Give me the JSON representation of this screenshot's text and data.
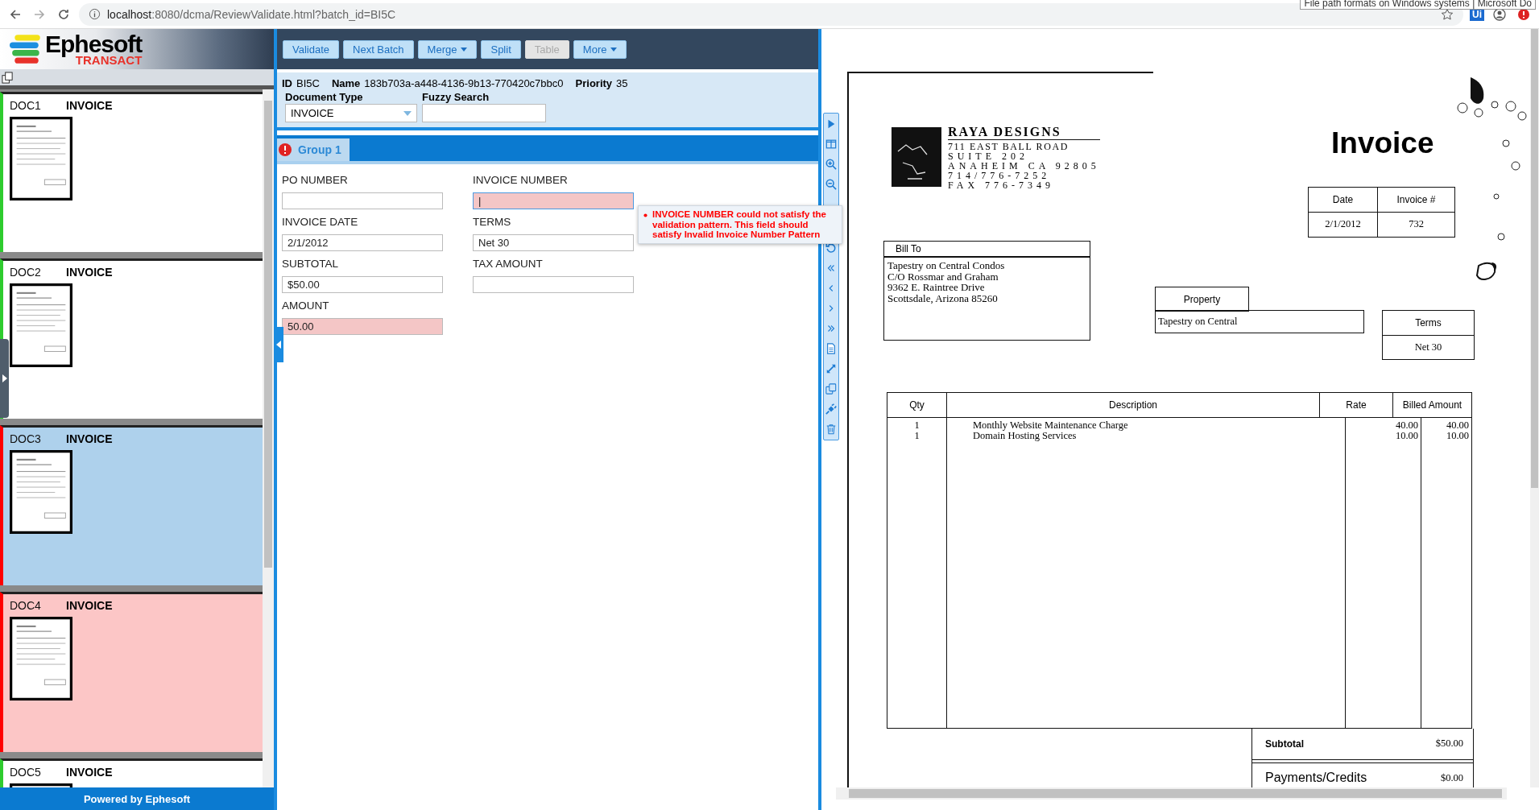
{
  "browser": {
    "url_host": "localhost",
    "url_path": ":8080/dcma/ReviewValidate.html?batch_id=BI5C",
    "tooltip": "File path formats on Windows systems | Microsoft Do",
    "extension_label": "Ui"
  },
  "logo": {
    "name": "Ephesoft",
    "tagline": "TRANSACT"
  },
  "documents": [
    {
      "id": "DOC1",
      "type": "INVOICE",
      "valid": true,
      "selected": false
    },
    {
      "id": "DOC2",
      "type": "INVOICE",
      "valid": true,
      "selected": false
    },
    {
      "id": "DOC3",
      "type": "INVOICE",
      "valid": false,
      "selected": true
    },
    {
      "id": "DOC4",
      "type": "INVOICE",
      "valid": false,
      "selected": false
    },
    {
      "id": "DOC5",
      "type": "INVOICE",
      "valid": true,
      "selected": false
    }
  ],
  "footer": "Powered by Ephesoft",
  "toolbar": [
    {
      "label": "Validate",
      "dropdown": false,
      "disabled": false
    },
    {
      "label": "Next Batch",
      "dropdown": false,
      "disabled": false
    },
    {
      "label": "Merge",
      "dropdown": true,
      "disabled": false
    },
    {
      "label": "Split",
      "dropdown": false,
      "disabled": false
    },
    {
      "label": "Table",
      "dropdown": false,
      "disabled": true
    },
    {
      "label": "More",
      "dropdown": true,
      "disabled": false
    }
  ],
  "batch": {
    "id_label": "ID",
    "id": "BI5C",
    "name_label": "Name",
    "name": "183b703a-a448-4136-9b13-770420c7bbc0",
    "priority_label": "Priority",
    "priority": "35"
  },
  "document_type": {
    "label": "Document Type",
    "value": "INVOICE"
  },
  "fuzzy_search": {
    "label": "Fuzzy Search"
  },
  "group_tab": {
    "label": "Group 1",
    "error": true
  },
  "fields": [
    {
      "label": "PO NUMBER",
      "error": false,
      "focused": false
    },
    {
      "label": "INVOICE NUMBER",
      "value": "|",
      "error": true,
      "focused": true
    },
    {
      "label": "INVOICE DATE",
      "value": "2/1/2012",
      "error": false,
      "focused": false
    },
    {
      "label": "TERMS",
      "value": "Net 30",
      "error": false,
      "focused": false
    },
    {
      "label": "SUBTOTAL",
      "value": "$50.00",
      "error": false,
      "focused": false
    },
    {
      "label": "TAX AMOUNT",
      "error": false,
      "focused": false
    },
    {
      "label": "AMOUNT",
      "value": "50.00",
      "error": true,
      "focused": false
    }
  ],
  "validation_message": "INVOICE NUMBER could not satisfy the validation pattern. This field should satisfy Invalid Invoice Number Pattern",
  "invoice": {
    "company": "RAYA DESIGNS",
    "address_lines": [
      "711 EAST BALL ROAD",
      "SUITE 202",
      "ANAHEIM CA 92805",
      "714/776-7252",
      "FAX 776-7349"
    ],
    "title": "Invoice",
    "date_label": "Date",
    "invoice_no_label": "Invoice #",
    "date": "2/1/2012",
    "invoice_no": "732",
    "bill_to_label": "Bill To",
    "bill_to": [
      "Tapestry on Central Condos",
      "C/O Rossmar and Graham",
      "9362 E. Raintree Drive",
      "Scottsdale, Arizona  85260"
    ],
    "property_label": "Property",
    "property": "Tapestry on Central",
    "terms_label": "Terms",
    "terms": "Net 30",
    "columns": [
      "Qty",
      "Description",
      "Rate",
      "Billed Amount"
    ],
    "lines": [
      {
        "qty": "1",
        "description": "Monthly Website Maintenance Charge",
        "rate": "40.00",
        "amount": "40.00"
      },
      {
        "qty": "1",
        "description": "Domain Hosting Services",
        "rate": "10.00",
        "amount": "10.00"
      }
    ],
    "subtotal_label": "Subtotal",
    "subtotal": "$50.00",
    "payments_label": "Payments/Credits",
    "payments": "$0.00"
  }
}
